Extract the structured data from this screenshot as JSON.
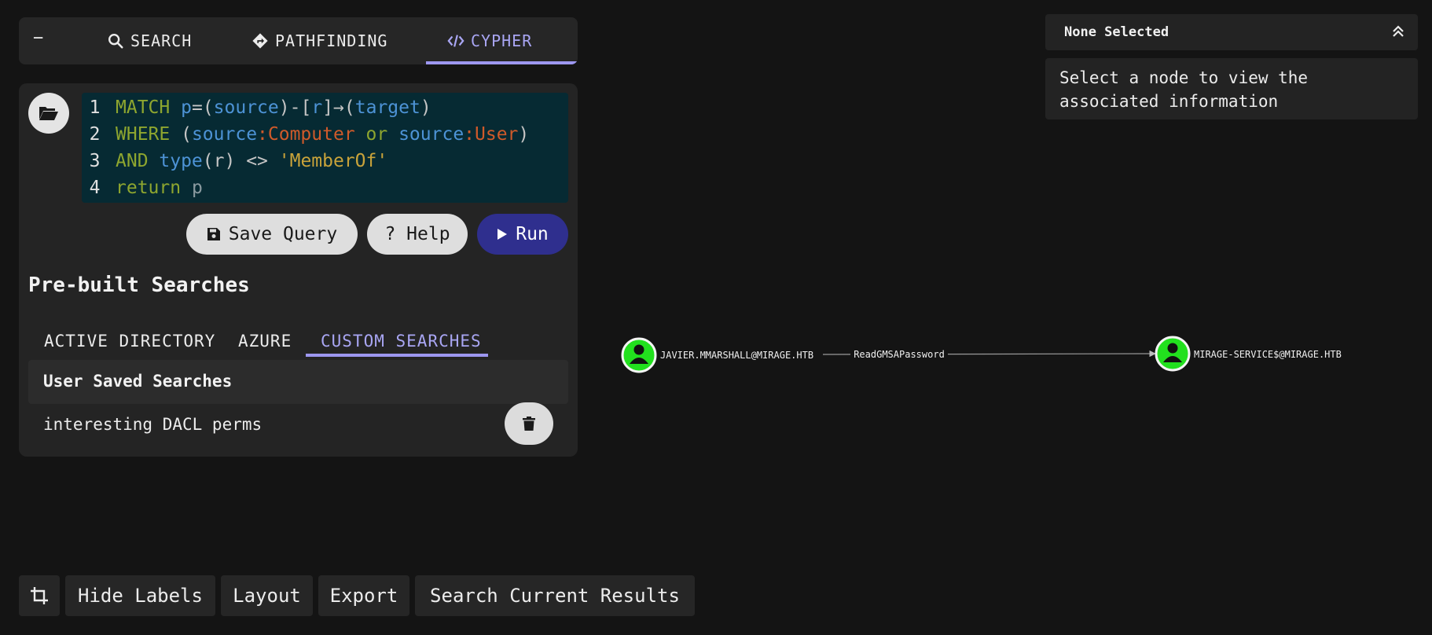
{
  "tabs": {
    "collapse_symbol": "−",
    "search": "SEARCH",
    "pathfinding": "PATHFINDING",
    "cypher": "CYPHER"
  },
  "editor": {
    "lines": [
      {
        "n": "1",
        "tokens": [
          [
            "k",
            "MATCH "
          ],
          [
            "f",
            "p"
          ],
          [
            "g",
            "="
          ],
          [
            "g",
            "("
          ],
          [
            "f",
            "source"
          ],
          [
            "g",
            ")"
          ],
          [
            "g",
            "-["
          ],
          [
            "f",
            "r"
          ],
          [
            "g",
            "]"
          ],
          [
            "g",
            "→"
          ],
          [
            "g",
            "("
          ],
          [
            "f",
            "target"
          ],
          [
            "g",
            ")"
          ]
        ]
      },
      {
        "n": "2",
        "tokens": [
          [
            "k",
            "WHERE "
          ],
          [
            "g",
            "("
          ],
          [
            "f",
            "source"
          ],
          [
            "l",
            ":Computer "
          ],
          [
            "k",
            "or "
          ],
          [
            "f",
            "source"
          ],
          [
            "l",
            ":User"
          ],
          [
            "g",
            ")"
          ]
        ]
      },
      {
        "n": "3",
        "tokens": [
          [
            "k",
            "AND "
          ],
          [
            "f",
            "type"
          ],
          [
            "g",
            "("
          ],
          [
            "g",
            "r"
          ],
          [
            "g",
            ") "
          ],
          [
            "g",
            "<> "
          ],
          [
            "s",
            "'MemberOf'"
          ]
        ]
      },
      {
        "n": "4",
        "tokens": [
          [
            "k",
            "return "
          ],
          [
            "p",
            "p"
          ]
        ]
      }
    ]
  },
  "buttons": {
    "save_query": "Save Query",
    "help": "? Help",
    "run": "Run"
  },
  "prebuilt": {
    "title": "Pre-built Searches",
    "tabs": [
      "ACTIVE DIRECTORY",
      "AZURE",
      "CUSTOM SEARCHES"
    ],
    "section_header": "User Saved Searches",
    "items": [
      "interesting DACL perms"
    ]
  },
  "info_panel": {
    "title": "None Selected",
    "body": "Select a node to view the associated information"
  },
  "graph": {
    "source_node": "JAVIER.MMARSHALL@MIRAGE.HTB",
    "target_node": "MIRAGE-SERVICE$@MIRAGE.HTB",
    "edge_label": "ReadGMSAPassword",
    "node_color": "#22e01e"
  },
  "toolbar": {
    "hide_labels": "Hide Labels",
    "layout": "Layout",
    "export": "Export",
    "search_results": "Search Current Results"
  }
}
